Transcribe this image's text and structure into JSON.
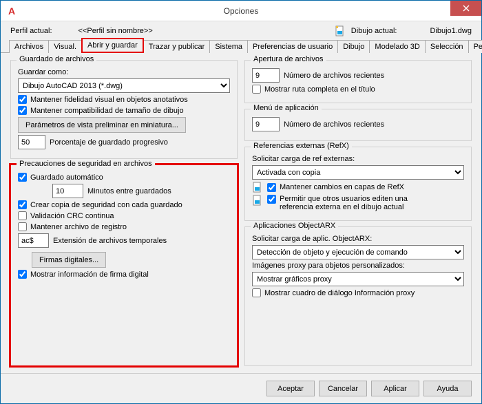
{
  "window": {
    "title": "Opciones"
  },
  "profile": {
    "current_label": "Perfil actual:",
    "current_value": "<<Perfil sin nombre>>",
    "drawing_label": "Dibujo actual:",
    "drawing_value": "Dibujo1.dwg"
  },
  "tabs": {
    "files": "Archivos",
    "visual": "Visual.",
    "open_save": "Abrir y guardar",
    "plot": "Trazar y publicar",
    "system": "Sistema",
    "user": "Preferencias de usuario",
    "drawing": "Dibujo",
    "model3d": "Modelado 3D",
    "selection": "Selección",
    "perf": "Per"
  },
  "left": {
    "save": {
      "title": "Guardado de archivos",
      "save_as_label": "Guardar como:",
      "save_as_value": "Dibujo AutoCAD 2013 (*.dwg)",
      "chk_visual": "Mantener fidelidad visual en objetos anotativos",
      "chk_compat": "Mantener compatibilidad de tamaño de dibujo",
      "btn_thumb": "Parámetros de vista preliminar en miniatura...",
      "incr_value": "50",
      "incr_label": "Porcentaje de guardado progresivo"
    },
    "safety": {
      "title": "Precauciones de seguridad en archivos",
      "chk_autosave": "Guardado automático",
      "autosave_value": "10",
      "autosave_label": "Minutos entre guardados",
      "chk_backup": "Crear copia de seguridad con cada guardado",
      "chk_crc": "Validación CRC continua",
      "chk_log": "Mantener archivo de registro",
      "temp_ext_value": "ac$",
      "temp_ext_label": "Extensión de archivos temporales",
      "btn_sig": "Firmas digitales...",
      "chk_sig_info": "Mostrar información de firma digital"
    }
  },
  "right": {
    "open": {
      "title": "Apertura de archivos",
      "recent_value": "9",
      "recent_label": "Número de archivos recientes",
      "chk_fullpath": "Mostrar ruta completa en el título"
    },
    "appmenu": {
      "title": "Menú de aplicación",
      "recent_value": "9",
      "recent_label": "Número de archivos recientes"
    },
    "xref": {
      "title": "Referencias externas (RefX)",
      "load_label": "Solicitar carga de ref externas:",
      "load_value": "Activada con copia",
      "chk_layers": "Mantener cambios en capas de RefX",
      "chk_edit": "Permitir que otros usuarios editen una referencia externa en el dibujo actual"
    },
    "arx": {
      "title": "Aplicaciones ObjectARX",
      "load_label": "Solicitar carga de aplic. ObjectARX:",
      "load_value": "Detección de objeto y ejecución de comando",
      "proxy_label": "Imágenes proxy para objetos personalizados:",
      "proxy_value": "Mostrar gráficos proxy",
      "chk_proxy_dlg": "Mostrar cuadro de diálogo Información proxy"
    }
  },
  "footer": {
    "ok": "Aceptar",
    "cancel": "Cancelar",
    "apply": "Aplicar",
    "help": "Ayuda"
  }
}
